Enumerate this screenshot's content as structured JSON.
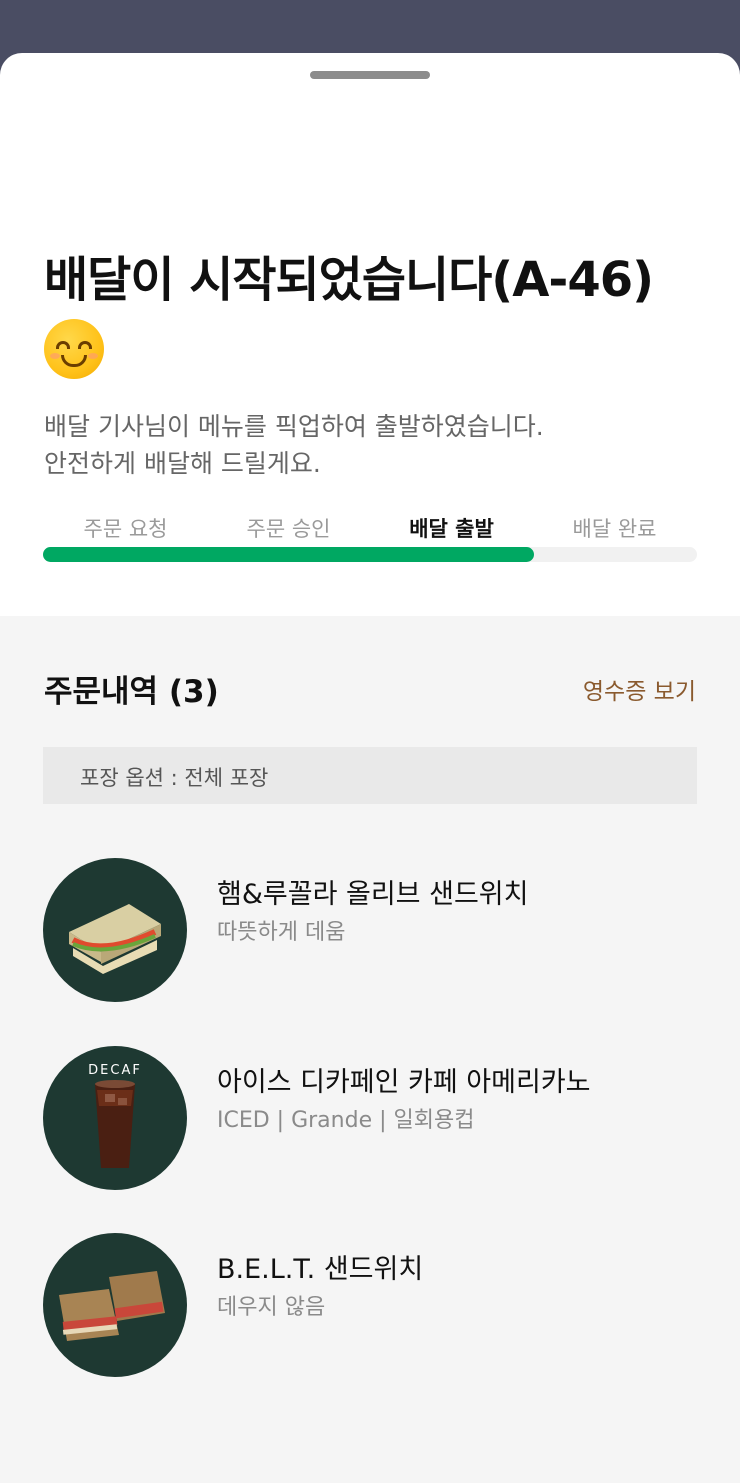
{
  "status": {
    "title": "배달이 시작되었습니다(A-46)",
    "emoji": "smiling-face-icon",
    "message_line1": "배달 기사님이 메뉴를 픽업하여 출발하였습니다.",
    "message_line2": "안전하게 배달해 드릴게요."
  },
  "progress": {
    "steps": [
      "주문 요청",
      "주문 승인",
      "배달 출발",
      "배달 완료"
    ],
    "active_step": "배달 출발",
    "fill_fraction": 0.75,
    "color": "#00a862"
  },
  "order": {
    "heading": "주문내역 (3)",
    "receipt_link": "영수증 보기",
    "packaging": "포장 옵션 : 전체 포장",
    "items": [
      {
        "name": "햄&루꼴라 올리브 샌드위치",
        "option": "따뜻하게 데움",
        "image": "ham-arugula-sandwich-image"
      },
      {
        "name": "아이스 디카페인 카페 아메리카노",
        "option": "ICED | Grande | 일회용컵",
        "image": "iced-decaf-americano-image",
        "badge": "DECAF"
      },
      {
        "name": "B.E.L.T. 샌드위치",
        "option": "데우지 않음",
        "image": "belt-sandwich-image"
      }
    ]
  },
  "colors": {
    "accent_green": "#00a862",
    "thumb_background": "#1e3932",
    "link_brown": "#8a5a2e"
  }
}
